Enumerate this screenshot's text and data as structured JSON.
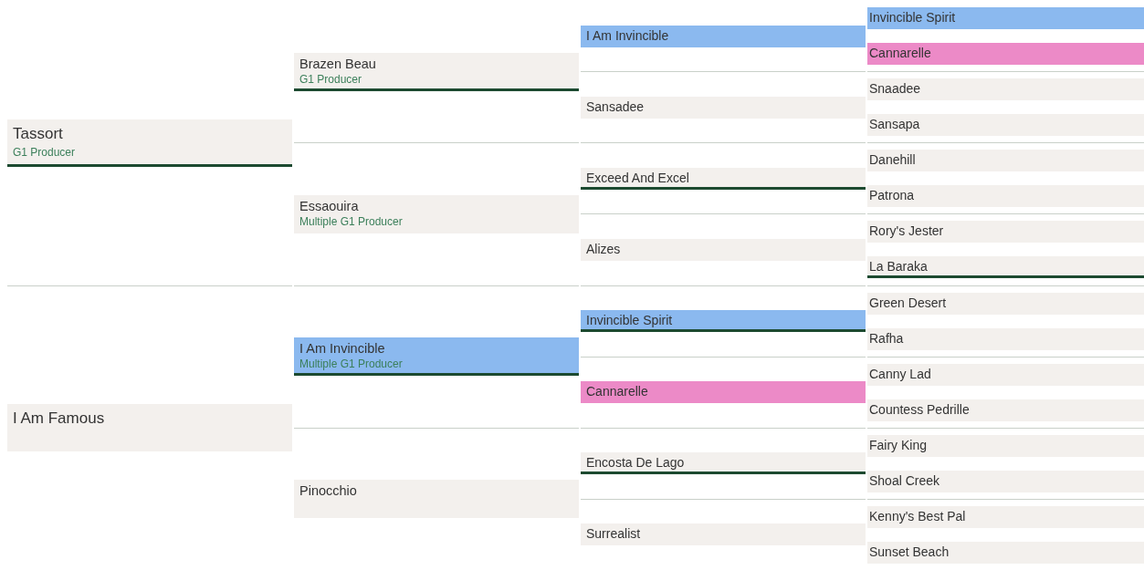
{
  "pedigree": [
    {
      "name": "Tassort",
      "note": "G1 Producer",
      "underlined": true,
      "children": [
        {
          "name": "Brazen Beau",
          "note": "G1 Producer",
          "underlined": true,
          "children": [
            {
              "name": "I Am Invincible",
              "color": "#8bb9ef",
              "underlined": false,
              "children": [
                {
                  "name": "Invincible Spirit",
                  "color": "#8bb9ef",
                  "underlined": false
                },
                {
                  "name": "Cannarelle",
                  "color": "#ec8ac7",
                  "underlined": false
                }
              ]
            },
            {
              "name": "Sansadee",
              "underlined": false,
              "children": [
                {
                  "name": "Snaadee",
                  "underlined": false
                },
                {
                  "name": "Sansapa",
                  "underlined": false
                }
              ]
            }
          ]
        },
        {
          "name": "Essaouira",
          "note": "Multiple G1 Producer",
          "underlined": false,
          "children": [
            {
              "name": "Exceed And Excel",
              "underlined": true,
              "children": [
                {
                  "name": "Danehill",
                  "underlined": false
                },
                {
                  "name": "Patrona",
                  "underlined": false
                }
              ]
            },
            {
              "name": "Alizes",
              "underlined": false,
              "children": [
                {
                  "name": "Rory's Jester",
                  "underlined": false
                },
                {
                  "name": "La Baraka",
                  "underlined": true
                }
              ]
            }
          ]
        }
      ]
    },
    {
      "name": "I Am Famous",
      "underlined": false,
      "children": [
        {
          "name": "I Am Invincible",
          "note": "Multiple G1 Producer",
          "color": "#8bb9ef",
          "underlined": true,
          "children": [
            {
              "name": "Invincible Spirit",
              "color": "#8bb9ef",
              "underlined": true,
              "children": [
                {
                  "name": "Green Desert",
                  "underlined": false
                },
                {
                  "name": "Rafha",
                  "underlined": false
                }
              ]
            },
            {
              "name": "Cannarelle",
              "color": "#ec8ac7",
              "underlined": false,
              "children": [
                {
                  "name": "Canny Lad",
                  "underlined": false
                },
                {
                  "name": "Countess Pedrille",
                  "underlined": false
                }
              ]
            }
          ]
        },
        {
          "name": "Pinocchio",
          "underlined": false,
          "children": [
            {
              "name": "Encosta De Lago",
              "underlined": true,
              "children": [
                {
                  "name": "Fairy King",
                  "underlined": false
                },
                {
                  "name": "Shoal Creek",
                  "underlined": false
                }
              ]
            },
            {
              "name": "Surrealist",
              "underlined": false,
              "children": [
                {
                  "name": "Kenny's Best Pal",
                  "underlined": false
                },
                {
                  "name": "Sunset Beach",
                  "underlined": false
                }
              ]
            }
          ]
        }
      ]
    }
  ]
}
